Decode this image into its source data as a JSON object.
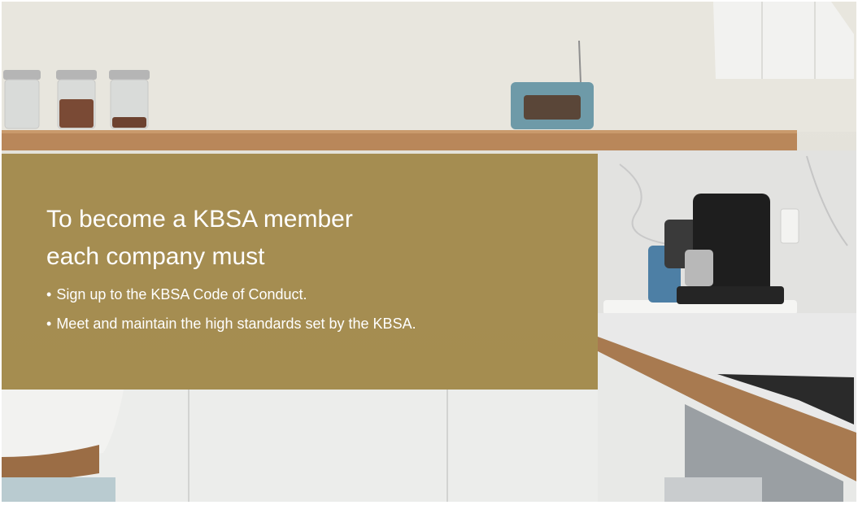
{
  "panel": {
    "heading_line1": "To become a KBSA member",
    "heading_line2": "each company must",
    "bullets": [
      "Sign up to the KBSA Code of Conduct.",
      "Meet and maintain the high standards set by the KBSA."
    ]
  },
  "colors": {
    "panel_overlay": "#a08746",
    "text": "#ffffff",
    "shelf": "#b9875a"
  }
}
